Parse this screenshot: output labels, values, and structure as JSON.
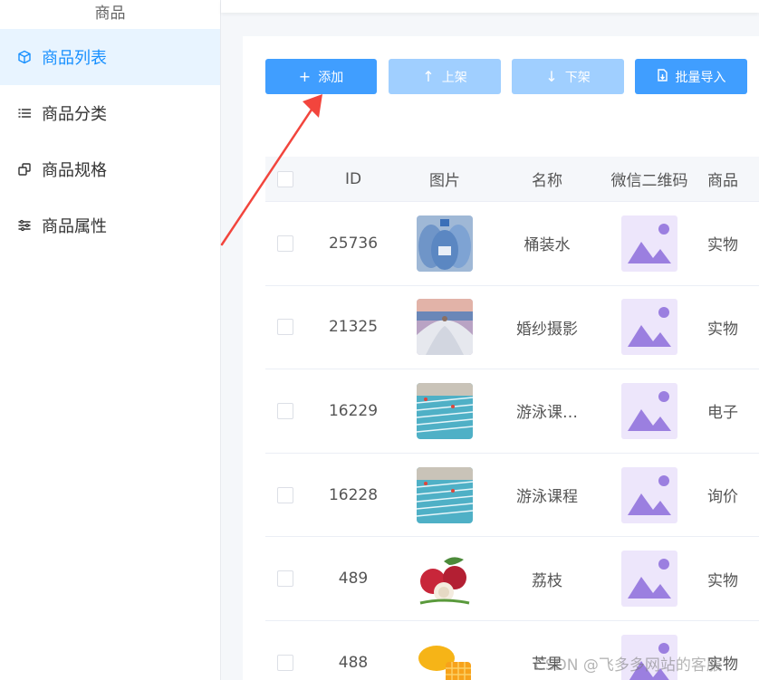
{
  "sidebar": {
    "header": "商品",
    "items": [
      {
        "label": "商品列表",
        "icon": "cube-icon",
        "active": true
      },
      {
        "label": "商品分类",
        "icon": "list-icon",
        "active": false
      },
      {
        "label": "商品规格",
        "icon": "spec-icon",
        "active": false
      },
      {
        "label": "商品属性",
        "icon": "sliders-icon",
        "active": false
      }
    ]
  },
  "toolbar": {
    "add_label": "添加",
    "up_label": "上架",
    "down_label": "下架",
    "import_label": "批量导入"
  },
  "table": {
    "headers": {
      "id": "ID",
      "image": "图片",
      "name": "名称",
      "qr": "微信二维码",
      "type": "商品"
    },
    "rows": [
      {
        "id": "25736",
        "name": "桶装水",
        "type": "实物",
        "thumb": "water-bottle-image"
      },
      {
        "id": "21325",
        "name": "婚纱摄影",
        "type": "实物",
        "thumb": "wedding-photo-image"
      },
      {
        "id": "16229",
        "name": "游泳课…",
        "type": "电子",
        "thumb": "swimming-pool-image"
      },
      {
        "id": "16228",
        "name": "游泳课程",
        "type": "询价",
        "thumb": "swimming-pool-image"
      },
      {
        "id": "489",
        "name": "荔枝",
        "type": "实物",
        "thumb": "lychee-image"
      },
      {
        "id": "488",
        "name": "芒果",
        "type": "实物",
        "thumb": "mango-image"
      }
    ]
  },
  "watermark": "CSDN @飞多多网站的客服",
  "colors": {
    "primary": "#409eff",
    "primary_disabled": "#a0cfff",
    "active_nav_bg": "#e8f4ff",
    "active_nav_text": "#1890ff",
    "qr_placeholder_bg": "#ede6fb",
    "qr_placeholder_fg": "#9b7fe0",
    "arrow": "#f2453d"
  }
}
